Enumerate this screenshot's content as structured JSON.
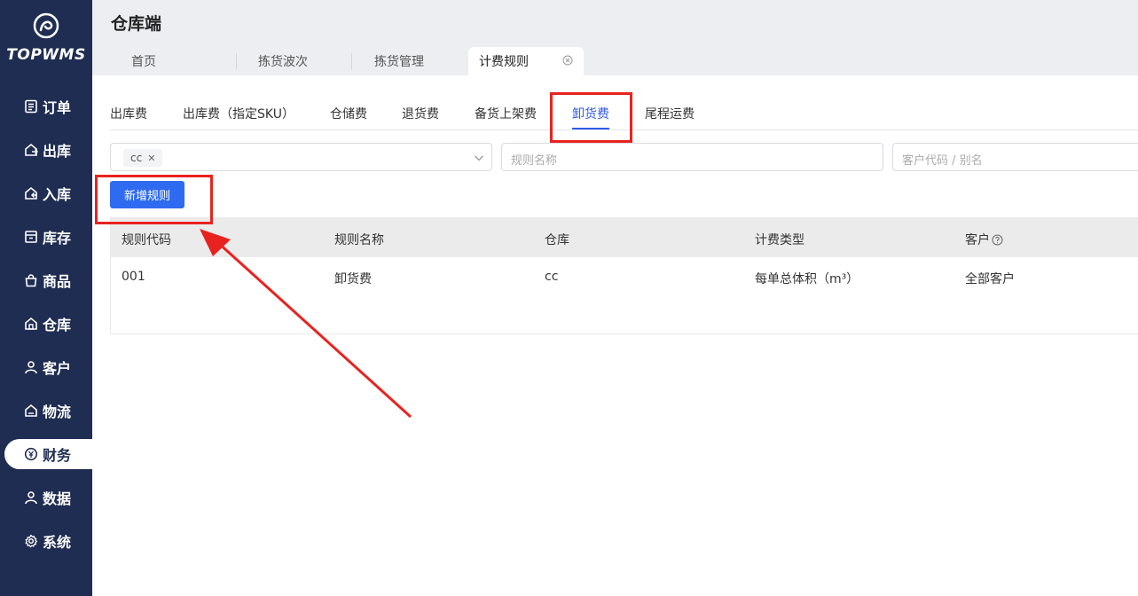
{
  "logo": {
    "text": "TOPWMS"
  },
  "sidebar": {
    "items": [
      {
        "label": "订单",
        "icon": "clipboard-icon"
      },
      {
        "label": "出库",
        "icon": "outbound-icon"
      },
      {
        "label": "入库",
        "icon": "inbound-icon"
      },
      {
        "label": "库存",
        "icon": "inventory-icon"
      },
      {
        "label": "商品",
        "icon": "bag-icon"
      },
      {
        "label": "仓库",
        "icon": "warehouse-icon"
      },
      {
        "label": "客户",
        "icon": "user-icon"
      },
      {
        "label": "物流",
        "icon": "logistics-icon"
      },
      {
        "label": "财务",
        "icon": "finance-icon",
        "active": true
      },
      {
        "label": "数据",
        "icon": "data-icon"
      },
      {
        "label": "系统",
        "icon": "gear-icon"
      }
    ]
  },
  "header": {
    "title": "仓库端",
    "tabs": [
      {
        "label": "首页"
      },
      {
        "label": "拣货波次"
      },
      {
        "label": "拣货管理"
      },
      {
        "label": "计费规则",
        "active": true
      }
    ]
  },
  "subtabs": [
    {
      "label": "出库费"
    },
    {
      "label": "出库费（指定SKU）"
    },
    {
      "label": "仓储费"
    },
    {
      "label": "退货费"
    },
    {
      "label": "备货上架费"
    },
    {
      "label": "卸货费",
      "active": true
    },
    {
      "label": "尾程运费"
    }
  ],
  "filters": {
    "warehouse_tag": "cc",
    "rule_name_placeholder": "规则名称",
    "customer_placeholder": "客户代码 / 别名"
  },
  "actions": {
    "add_rule": "新增规则"
  },
  "table": {
    "columns": [
      "规则代码",
      "规则名称",
      "仓库",
      "计费类型",
      "客户"
    ],
    "rows": [
      [
        "001",
        "卸货费",
        "cc",
        "每单总体积（m³）",
        "全部客户"
      ]
    ]
  },
  "colors": {
    "sidebar_bg": "#1f2d52",
    "accent": "#2f6bf0",
    "annotation_red": "#e8231f"
  }
}
